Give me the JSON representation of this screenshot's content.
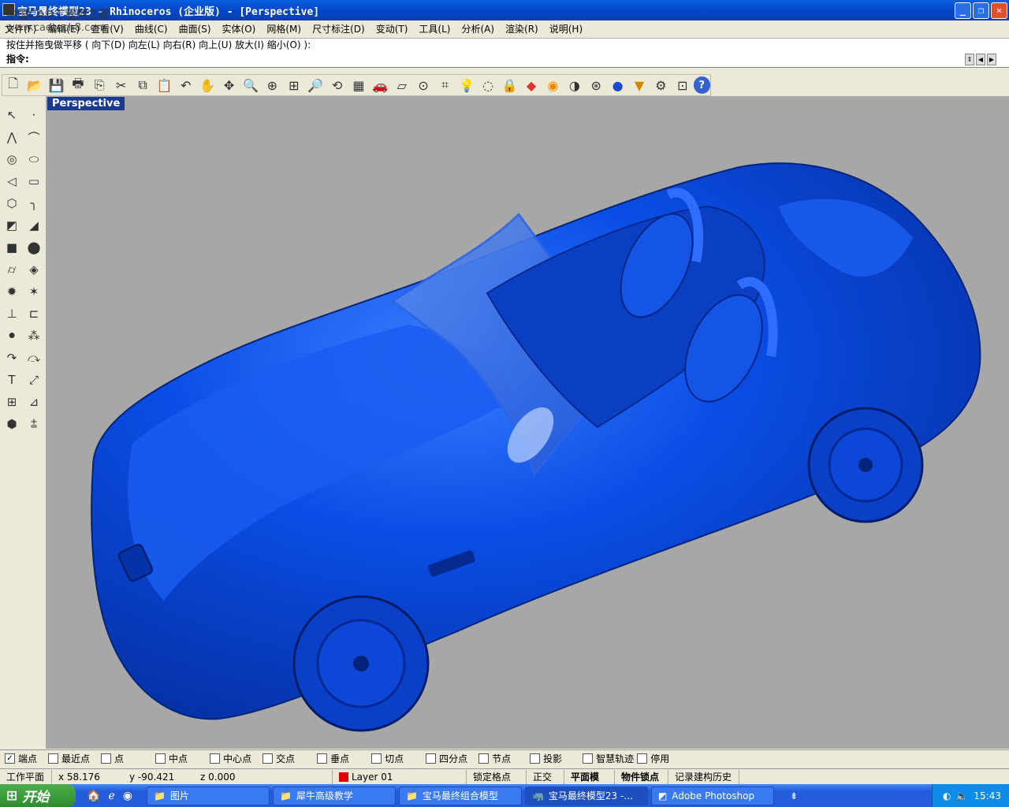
{
  "window": {
    "title": "宝马最终模型23 - Rhinoceros (企业版) - [Perspective]"
  },
  "watermark": {
    "line1": "中国CAD工程师之家",
    "line2": "www.cadtech8.com"
  },
  "menu": [
    "文件(F)",
    "编辑(E)",
    "查看(V)",
    "曲线(C)",
    "曲面(S)",
    "实体(O)",
    "网格(M)",
    "尺寸标注(D)",
    "变动(T)",
    "工具(L)",
    "分析(A)",
    "渲染(R)",
    "说明(H)"
  ],
  "command": {
    "history": "按住并拖曳做平移 ( 向下(D) 向左(L) 向右(R) 向上(U) 放大(I) 缩小(O) ):",
    "prompt": "指令:"
  },
  "viewport": {
    "label": "Perspective",
    "background": "#a7a7a7",
    "model_color": "#0a4ee6"
  },
  "osnap": [
    {
      "label": "端点",
      "checked": true
    },
    {
      "label": "最近点",
      "checked": false
    },
    {
      "label": "点",
      "checked": false
    },
    {
      "label": "中点",
      "checked": false
    },
    {
      "label": "中心点",
      "checked": false
    },
    {
      "label": "交点",
      "checked": false
    },
    {
      "label": "垂点",
      "checked": false
    },
    {
      "label": "切点",
      "checked": false
    },
    {
      "label": "四分点",
      "checked": false
    },
    {
      "label": "节点",
      "checked": false
    },
    {
      "label": "投影",
      "checked": false
    },
    {
      "label": "智慧轨迹",
      "checked": false
    },
    {
      "label": "停用",
      "checked": false
    }
  ],
  "status": {
    "plane": "工作平面",
    "x": "x 58.176",
    "y": "y -90.421",
    "z": "z 0.000",
    "layer": "Layer 01",
    "layer_color": "#e00000",
    "grid_snap": "锁定格点",
    "ortho": "正交",
    "planar": "平面模式",
    "osnap": "物件锁点",
    "history": "记录建构历史"
  },
  "taskbar": {
    "start": "开始",
    "tasks": [
      "图片",
      "犀牛高级教学",
      "宝马最终组合模型",
      "宝马最终模型23 -...",
      "Adobe Photoshop"
    ],
    "clock": "15:43"
  }
}
